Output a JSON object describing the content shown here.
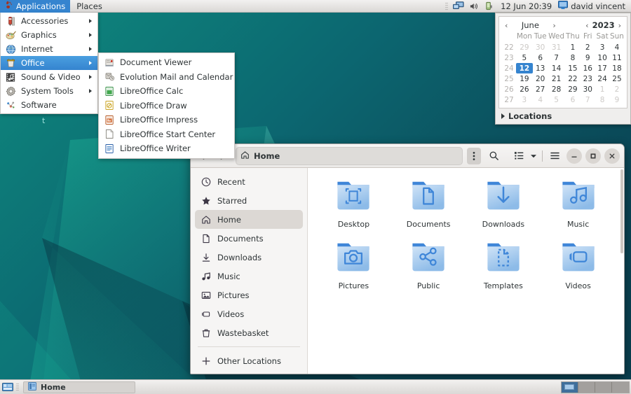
{
  "panel": {
    "applications_label": "Applications",
    "places_label": "Places",
    "clock": "12 Jun  20:39",
    "user": "david vincent",
    "icons": {
      "apps": "foot-icon",
      "network": "network-icon",
      "volume": "volume-icon",
      "battery": "battery-icon",
      "user": "monitor-icon"
    }
  },
  "app_menu": {
    "items": [
      {
        "label": "Accessories",
        "icon": "accessories-icon",
        "has_submenu": true,
        "selected": false
      },
      {
        "label": "Graphics",
        "icon": "graphics-icon",
        "has_submenu": true,
        "selected": false
      },
      {
        "label": "Internet",
        "icon": "internet-icon",
        "has_submenu": true,
        "selected": false
      },
      {
        "label": "Office",
        "icon": "office-icon",
        "has_submenu": true,
        "selected": true
      },
      {
        "label": "Sound & Video",
        "icon": "sound-video-icon",
        "has_submenu": true,
        "selected": false
      },
      {
        "label": "System Tools",
        "icon": "system-tools-icon",
        "has_submenu": true,
        "selected": false
      },
      {
        "label": "Software",
        "icon": "software-icon",
        "has_submenu": false,
        "selected": false
      }
    ]
  },
  "office_submenu": {
    "items": [
      {
        "label": "Document Viewer",
        "icon": "document-viewer-icon"
      },
      {
        "label": "Evolution Mail and Calendar",
        "icon": "evolution-icon"
      },
      {
        "label": "LibreOffice Calc",
        "icon": "libreoffice-calc-icon"
      },
      {
        "label": "LibreOffice Draw",
        "icon": "libreoffice-draw-icon"
      },
      {
        "label": "LibreOffice Impress",
        "icon": "libreoffice-impress-icon"
      },
      {
        "label": "LibreOffice Start Center",
        "icon": "libreoffice-start-icon"
      },
      {
        "label": "LibreOffice Writer",
        "icon": "libreoffice-writer-icon"
      }
    ]
  },
  "desktop_artifact": {
    "line1": "t"
  },
  "calendar": {
    "month": "June",
    "year": "2023",
    "prev_month_label": "‹",
    "next_month_label": "›",
    "prev_year_label": "‹",
    "next_year_label": "›",
    "weekday_headers": [
      "Mon",
      "Tue",
      "Wed",
      "Thu",
      "Fri",
      "Sat",
      "Sun"
    ],
    "selected_day": "12",
    "weeks": [
      {
        "wk": "22",
        "days": [
          {
            "d": "29",
            "dim": true
          },
          {
            "d": "30",
            "dim": true
          },
          {
            "d": "31",
            "dim": true
          },
          {
            "d": "1",
            "dim": false
          },
          {
            "d": "2",
            "dim": false
          },
          {
            "d": "3",
            "dim": false
          },
          {
            "d": "4",
            "dim": false
          }
        ]
      },
      {
        "wk": "23",
        "days": [
          {
            "d": "5",
            "dim": false
          },
          {
            "d": "6",
            "dim": false
          },
          {
            "d": "7",
            "dim": false
          },
          {
            "d": "8",
            "dim": false
          },
          {
            "d": "9",
            "dim": false
          },
          {
            "d": "10",
            "dim": false
          },
          {
            "d": "11",
            "dim": false
          }
        ]
      },
      {
        "wk": "24",
        "days": [
          {
            "d": "12",
            "dim": false,
            "sel": true
          },
          {
            "d": "13",
            "dim": false
          },
          {
            "d": "14",
            "dim": false
          },
          {
            "d": "15",
            "dim": false
          },
          {
            "d": "16",
            "dim": false
          },
          {
            "d": "17",
            "dim": false
          },
          {
            "d": "18",
            "dim": false
          }
        ]
      },
      {
        "wk": "25",
        "days": [
          {
            "d": "19",
            "dim": false
          },
          {
            "d": "20",
            "dim": false
          },
          {
            "d": "21",
            "dim": false
          },
          {
            "d": "22",
            "dim": false
          },
          {
            "d": "23",
            "dim": false
          },
          {
            "d": "24",
            "dim": false
          },
          {
            "d": "25",
            "dim": false
          }
        ]
      },
      {
        "wk": "26",
        "days": [
          {
            "d": "26",
            "dim": false
          },
          {
            "d": "27",
            "dim": false
          },
          {
            "d": "28",
            "dim": false
          },
          {
            "d": "29",
            "dim": false
          },
          {
            "d": "30",
            "dim": false
          },
          {
            "d": "1",
            "dim": true
          },
          {
            "d": "2",
            "dim": true
          }
        ]
      },
      {
        "wk": "27",
        "days": [
          {
            "d": "3",
            "dim": true
          },
          {
            "d": "4",
            "dim": true
          },
          {
            "d": "5",
            "dim": true
          },
          {
            "d": "6",
            "dim": true
          },
          {
            "d": "7",
            "dim": true
          },
          {
            "d": "8",
            "dim": true
          },
          {
            "d": "9",
            "dim": true
          }
        ]
      }
    ],
    "locations_label": "Locations"
  },
  "file_manager": {
    "title": "Home",
    "path_label": "Home",
    "header_icons": {
      "back": "back-arrow-icon",
      "forward": "forward-arrow-icon",
      "home": "home-icon",
      "kebab": "kebab-menu-icon",
      "search": "search-icon",
      "view_list": "list-view-icon",
      "view_dropdown": "chevron-down-icon",
      "hamburger": "hamburger-menu-icon",
      "minimize": "minimize-icon",
      "maximize": "maximize-icon",
      "close": "close-icon"
    },
    "sidebar": [
      {
        "label": "Recent",
        "icon": "clock-icon",
        "active": false
      },
      {
        "label": "Starred",
        "icon": "star-icon",
        "active": false
      },
      {
        "label": "Home",
        "icon": "home-icon",
        "active": true
      },
      {
        "label": "Documents",
        "icon": "document-icon",
        "active": false
      },
      {
        "label": "Downloads",
        "icon": "download-icon",
        "active": false
      },
      {
        "label": "Music",
        "icon": "music-note-icon",
        "active": false
      },
      {
        "label": "Pictures",
        "icon": "picture-icon",
        "active": false
      },
      {
        "label": "Videos",
        "icon": "video-icon",
        "active": false
      },
      {
        "label": "Wastebasket",
        "icon": "trash-icon",
        "active": false
      }
    ],
    "sidebar_footer": {
      "label": "Other Locations",
      "icon": "plus-icon"
    },
    "folders": [
      {
        "label": "Desktop",
        "icon": "desktop-folder-icon"
      },
      {
        "label": "Documents",
        "icon": "documents-folder-icon"
      },
      {
        "label": "Downloads",
        "icon": "downloads-folder-icon"
      },
      {
        "label": "Music",
        "icon": "music-folder-icon"
      },
      {
        "label": "Pictures",
        "icon": "pictures-folder-icon"
      },
      {
        "label": "Public",
        "icon": "public-folder-icon"
      },
      {
        "label": "Templates",
        "icon": "templates-folder-icon"
      },
      {
        "label": "Videos",
        "icon": "videos-folder-icon"
      }
    ]
  },
  "taskbar": {
    "show_desktop_icon": "show-desktop-icon",
    "window_button": {
      "label": "Home",
      "icon": "file-manager-icon"
    },
    "workspaces": [
      {
        "active": true
      },
      {
        "active": false
      },
      {
        "active": false
      },
      {
        "active": false
      }
    ]
  },
  "colors": {
    "accent": "#3584cf",
    "panel_bg": "#e4e2e0",
    "wallpaper_teal": "#0c6670",
    "folder_blue": "#3a85d8"
  }
}
